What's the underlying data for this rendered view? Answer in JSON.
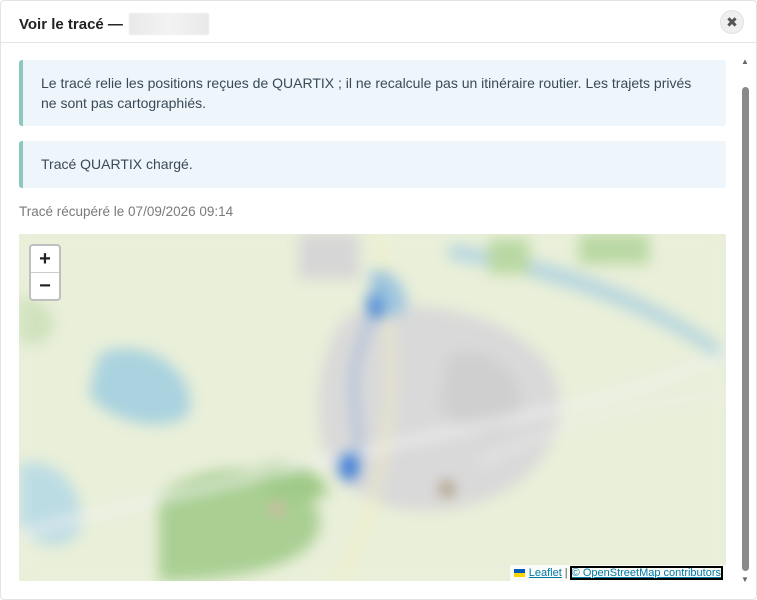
{
  "modal": {
    "title": "Voir le tracé —",
    "close_icon": "close-icon"
  },
  "alerts": [
    {
      "text": "Le tracé relie les positions reçues de QUARTIX ; il ne recalcule pas un itinéraire routier. Les trajets privés ne sont pas cartographiés."
    },
    {
      "text": "Tracé QUARTIX chargé."
    }
  ],
  "fetched_text": "Tracé récupéré le 07/09/2026 09:14",
  "map": {
    "zoom_in_label": "+",
    "zoom_out_label": "−",
    "attribution": {
      "leaflet_label": "Leaflet",
      "separator": "|",
      "osm_label": "© OpenStreetMap contributors"
    },
    "colors": {
      "land": "#e9efd9",
      "water": "#aad3df",
      "forest": "#a9cf93",
      "urban": "#d9d9d9",
      "track": "#3a7bd5"
    }
  }
}
